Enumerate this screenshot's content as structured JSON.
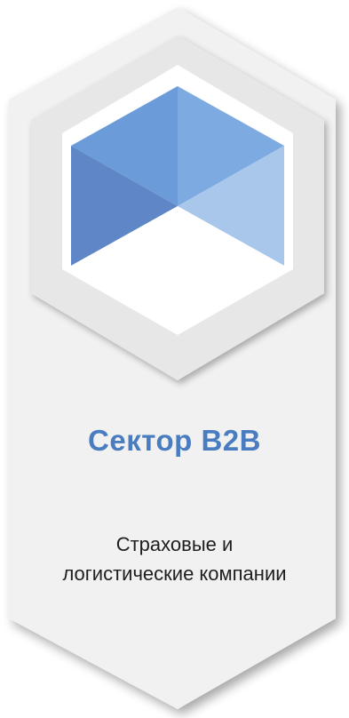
{
  "card": {
    "title": "Сектор B2B",
    "description": "Страховые и логистические компании",
    "icon": "isometric-cube-icon",
    "colors": {
      "title": "#4a7cc0",
      "description": "#1e1e1e",
      "card_fill": "#f1f1f1",
      "frame_fill": "#e7e7e7",
      "cube_top_left": "#6b9bd8",
      "cube_top_right": "#7eaae2",
      "cube_left": "#5f87c8",
      "cube_right": "#a9c7ea",
      "cube_bottom": "#ffffff"
    }
  }
}
